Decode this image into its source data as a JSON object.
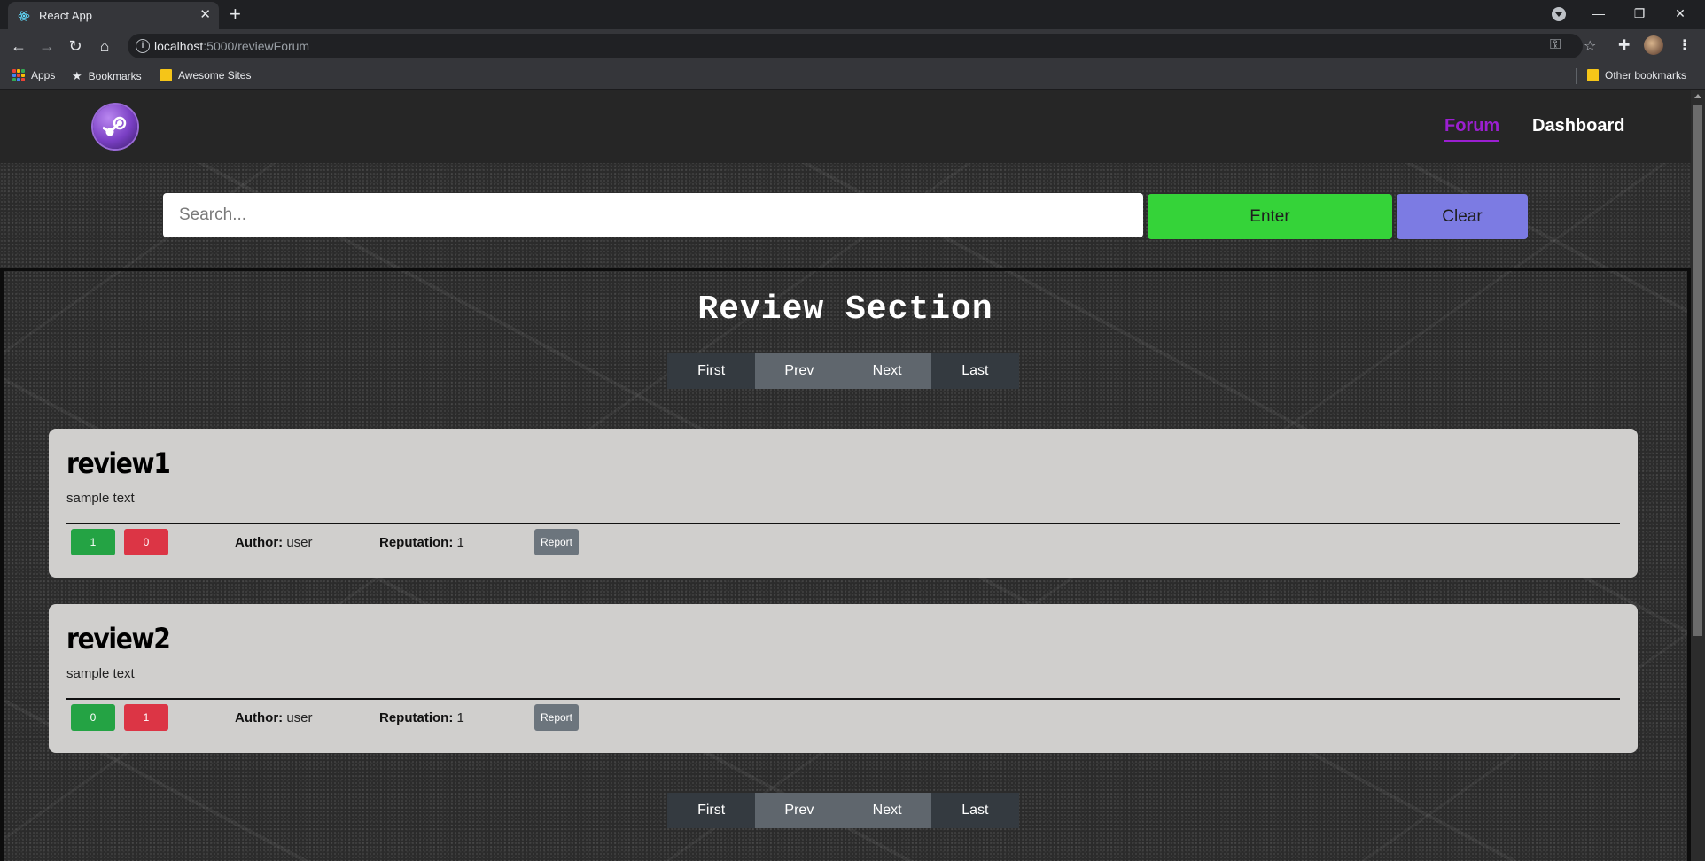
{
  "browser": {
    "tab_title": "React App",
    "url_host": "localhost",
    "url_path": ":5000/reviewForum",
    "bookmarks": [
      {
        "label": "Apps"
      },
      {
        "label": "Bookmarks"
      },
      {
        "label": "Awesome Sites"
      }
    ],
    "other_bookmarks": "Other bookmarks"
  },
  "header": {
    "nav_forum": "Forum",
    "nav_dashboard": "Dashboard"
  },
  "search": {
    "placeholder": "Search...",
    "enter_label": "Enter",
    "clear_label": "Clear"
  },
  "section": {
    "title": "Review Section"
  },
  "pagination": {
    "first": "First",
    "prev": "Prev",
    "next": "Next",
    "last": "Last"
  },
  "reviews": [
    {
      "title": "review1",
      "body": "sample text",
      "upvotes": "1",
      "downvotes": "0",
      "author_label": "Author:",
      "author": "user",
      "reputation_label": "Reputation:",
      "reputation": "1",
      "report_label": "Report"
    },
    {
      "title": "review2",
      "body": "sample text",
      "upvotes": "0",
      "downvotes": "1",
      "author_label": "Author:",
      "author": "user",
      "reputation_label": "Reputation:",
      "reputation": "1",
      "report_label": "Report"
    }
  ],
  "colors": {
    "nav_active": "#9b1fd1",
    "enter_button": "#35d339",
    "clear_button": "#7c7be3",
    "upvote": "#24a344",
    "downvote": "#dc3545",
    "report": "#6c757d",
    "card": "#d0cfcd"
  },
  "icons": [
    "react-favicon",
    "close-icon",
    "plus-icon",
    "back-icon",
    "forward-icon",
    "reload-icon",
    "home-icon",
    "info-icon",
    "key-icon",
    "star-icon",
    "extensions-icon",
    "menu-icon",
    "steam-logo"
  ]
}
